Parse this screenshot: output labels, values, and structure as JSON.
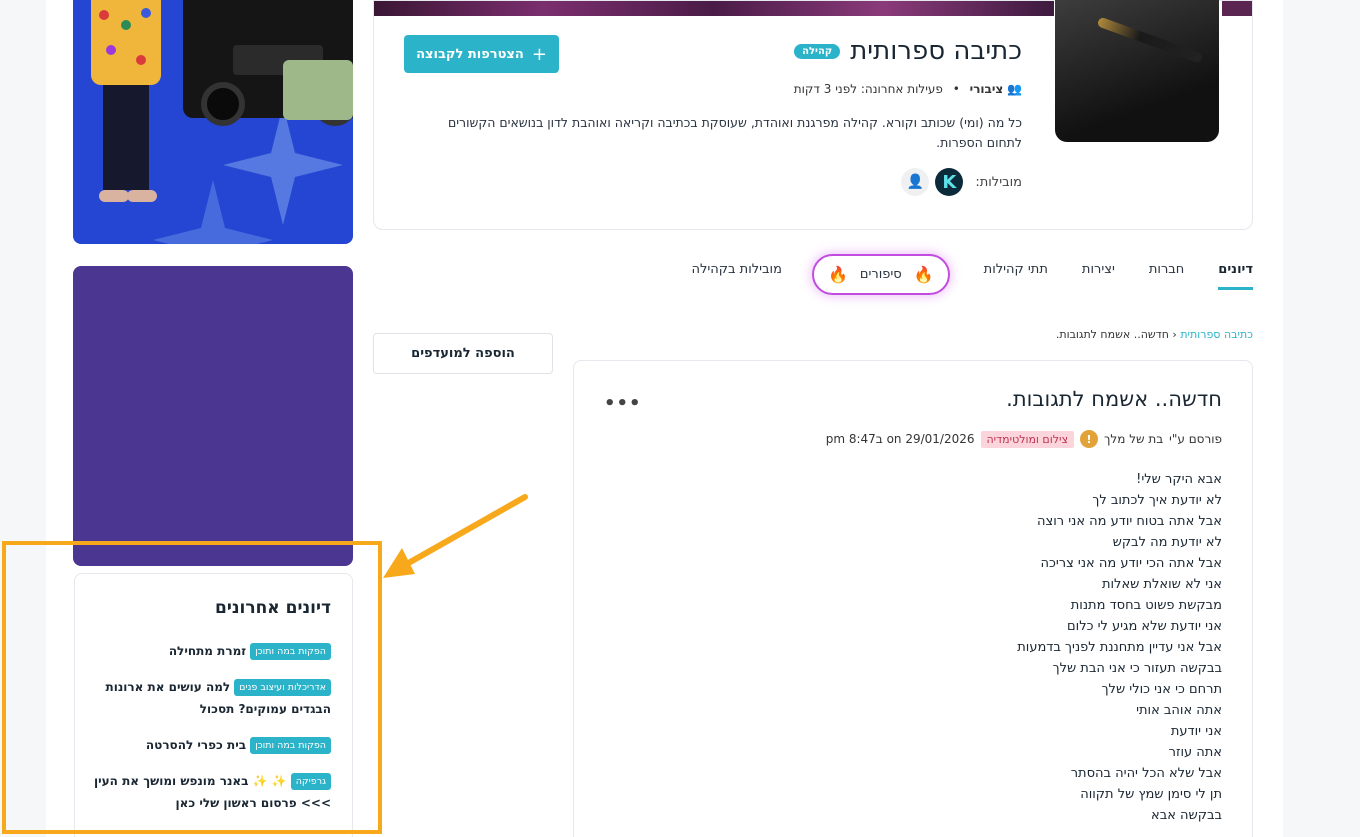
{
  "group": {
    "title": "כתיבה ספרותית",
    "badge": "קהילה",
    "privacy": "ציבורי",
    "separator": "•",
    "last_activity": "פעילות אחרונה: לפני 3 דקות",
    "description": "כל מה (ומי) שכותב וקורא. קהילה מפרגנת ואוהדת, שעוסקת בכתיבה וקריאה ואוהבת לדון בנושאים הקשורים לתחום הספרות.",
    "leaders_label": "מובילות:",
    "leader_avatar_letter": "K",
    "join_label": "הצטרפות לקבוצה",
    "join_icon": "+"
  },
  "tabs": [
    {
      "label": "דיונים",
      "active": true
    },
    {
      "label": "חברות",
      "active": false
    },
    {
      "label": "יצירות",
      "active": false
    },
    {
      "label": "תתי קהילות",
      "active": false
    },
    {
      "label": "סיפורים",
      "active": false,
      "highlighted": true
    },
    {
      "label": "מובילות בקהילה",
      "active": false
    }
  ],
  "breadcrumb": {
    "link": "כתיבה ספרותית",
    "sep": "‹",
    "current": "חדשה.. אשמח לתגובות."
  },
  "favorites_button": "הוספה למועדפים",
  "post": {
    "title": "חדשה.. אשמח לתגובות.",
    "more_icon": "•••",
    "posted_by_prefix": "פורסם ע\"י",
    "author": "בת של מלך",
    "warn_icon": "!",
    "category": "צילום ומולטימדיה",
    "date": "on 29/01/2026 ב8:47 pm",
    "lines": [
      "אבא היקר שלי!",
      "לא יודעת איך לכתוב לך",
      "אבל אתה בטוח יודע מה אני רוצה",
      "לא יודעת מה לבקש",
      "אבל אתה הכי יודע מה אני צריכה",
      "אני לא שואלת שאלות",
      "מבקשת פשוט בחסד מתנות",
      "אני יודעת שלא מגיע לי כלום",
      "אבל אני עדיין מתחננת לפניך בדמעות",
      "בבקשה תעזור כי אני הבת שלך",
      "תרחם כי אני כולי שלך",
      "אתה אוהב אותי",
      "אני יודעת",
      "אתה עוזר",
      "אבל שלא הכל יהיה בהסתר",
      "תן לי סימן שמץ של תקווה",
      "בבקשה אבא"
    ]
  },
  "recent": {
    "title": "דיונים אחרונים",
    "items": [
      {
        "tag": "הפקות במה ותוכן",
        "text": "זמרת מתחילה"
      },
      {
        "tag": "אדריכלות ועיצוב פנים",
        "text": "למה עושים את ארונות הבגדים עמוקים? תסכול"
      },
      {
        "tag": "הפקות במה ותוכן",
        "text": "בית כפרי להסרטה"
      },
      {
        "tag": "גרפיקה",
        "text": "✨ ✨ באנר מונפש ומושך את העין >>> פרסום ראשון שלי כאן"
      }
    ]
  },
  "colors": {
    "accent": "#2bb4c9",
    "highlight": "#f7a81b",
    "stories_glow": "#c24be0",
    "category_bg": "#fbd4dc",
    "ad_purple": "#4b3691"
  },
  "icons": {
    "privacy": "users-icon",
    "flame": "🔥"
  }
}
